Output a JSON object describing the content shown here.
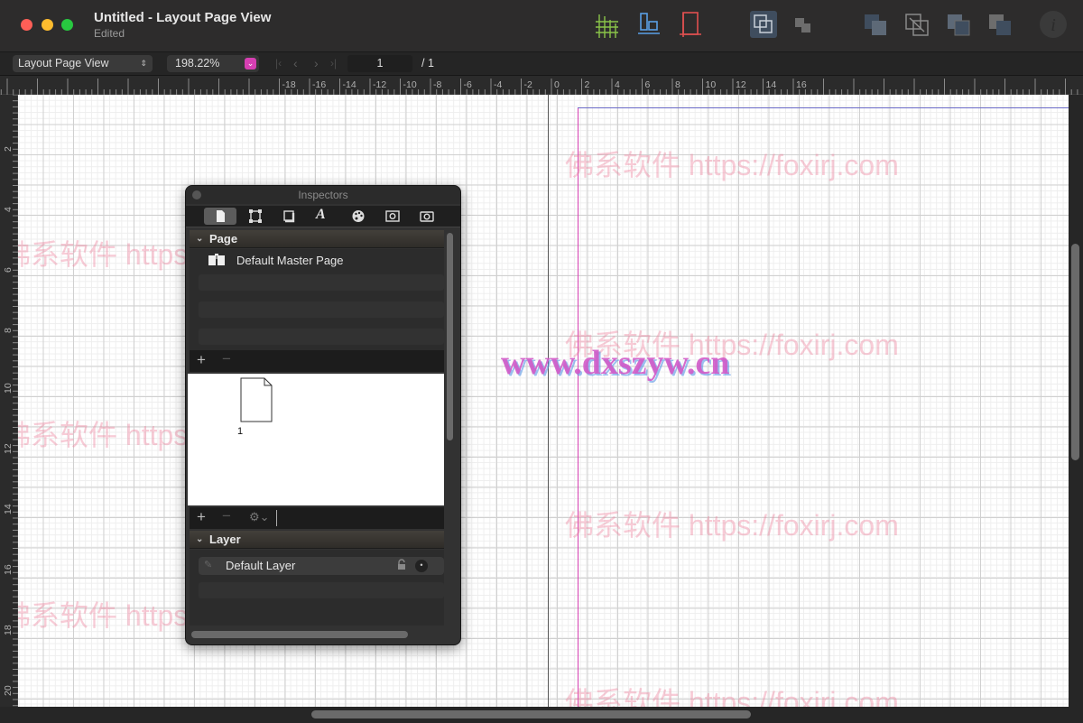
{
  "window": {
    "title": "Untitled - Layout Page View",
    "subtitle": "Edited"
  },
  "toolbar": {
    "view_mode": "Layout Page View",
    "zoom": "198.22%",
    "page_number": "1",
    "page_total": "/ 1"
  },
  "ruler": {
    "h_ticks": [
      "-18",
      "-16",
      "-14",
      "-12",
      "-10",
      "-8",
      "-6",
      "-4",
      "-2",
      "0",
      "2",
      "4",
      "6",
      "8",
      "10",
      "12",
      "14",
      "16"
    ],
    "v_ticks": [
      "2",
      "4",
      "6",
      "8",
      "10",
      "12",
      "14",
      "16",
      "18",
      "20"
    ]
  },
  "watermarks": [
    "佛系软件 https://foxirj.com",
    "佛系软件 https://foxirj.com",
    "佛系软件 https://foxirj.com",
    "佛系软件 https://foxirj.com",
    "佛系软件 https://foxirj.com",
    "佛系软件 https://foxirj.com",
    "佛系软件 https://foxirj.com",
    "www.dxszyw.cn"
  ],
  "inspector": {
    "title": "Inspectors",
    "page_section": "Page",
    "master_page": "Default Master Page",
    "thumb_label": "1",
    "layer_section": "Layer",
    "layer_name": "Default Layer"
  },
  "colors": {
    "accent": "#d63fb2",
    "close": "#ff5f57",
    "minimize": "#febc2e",
    "zoom": "#28c840"
  }
}
